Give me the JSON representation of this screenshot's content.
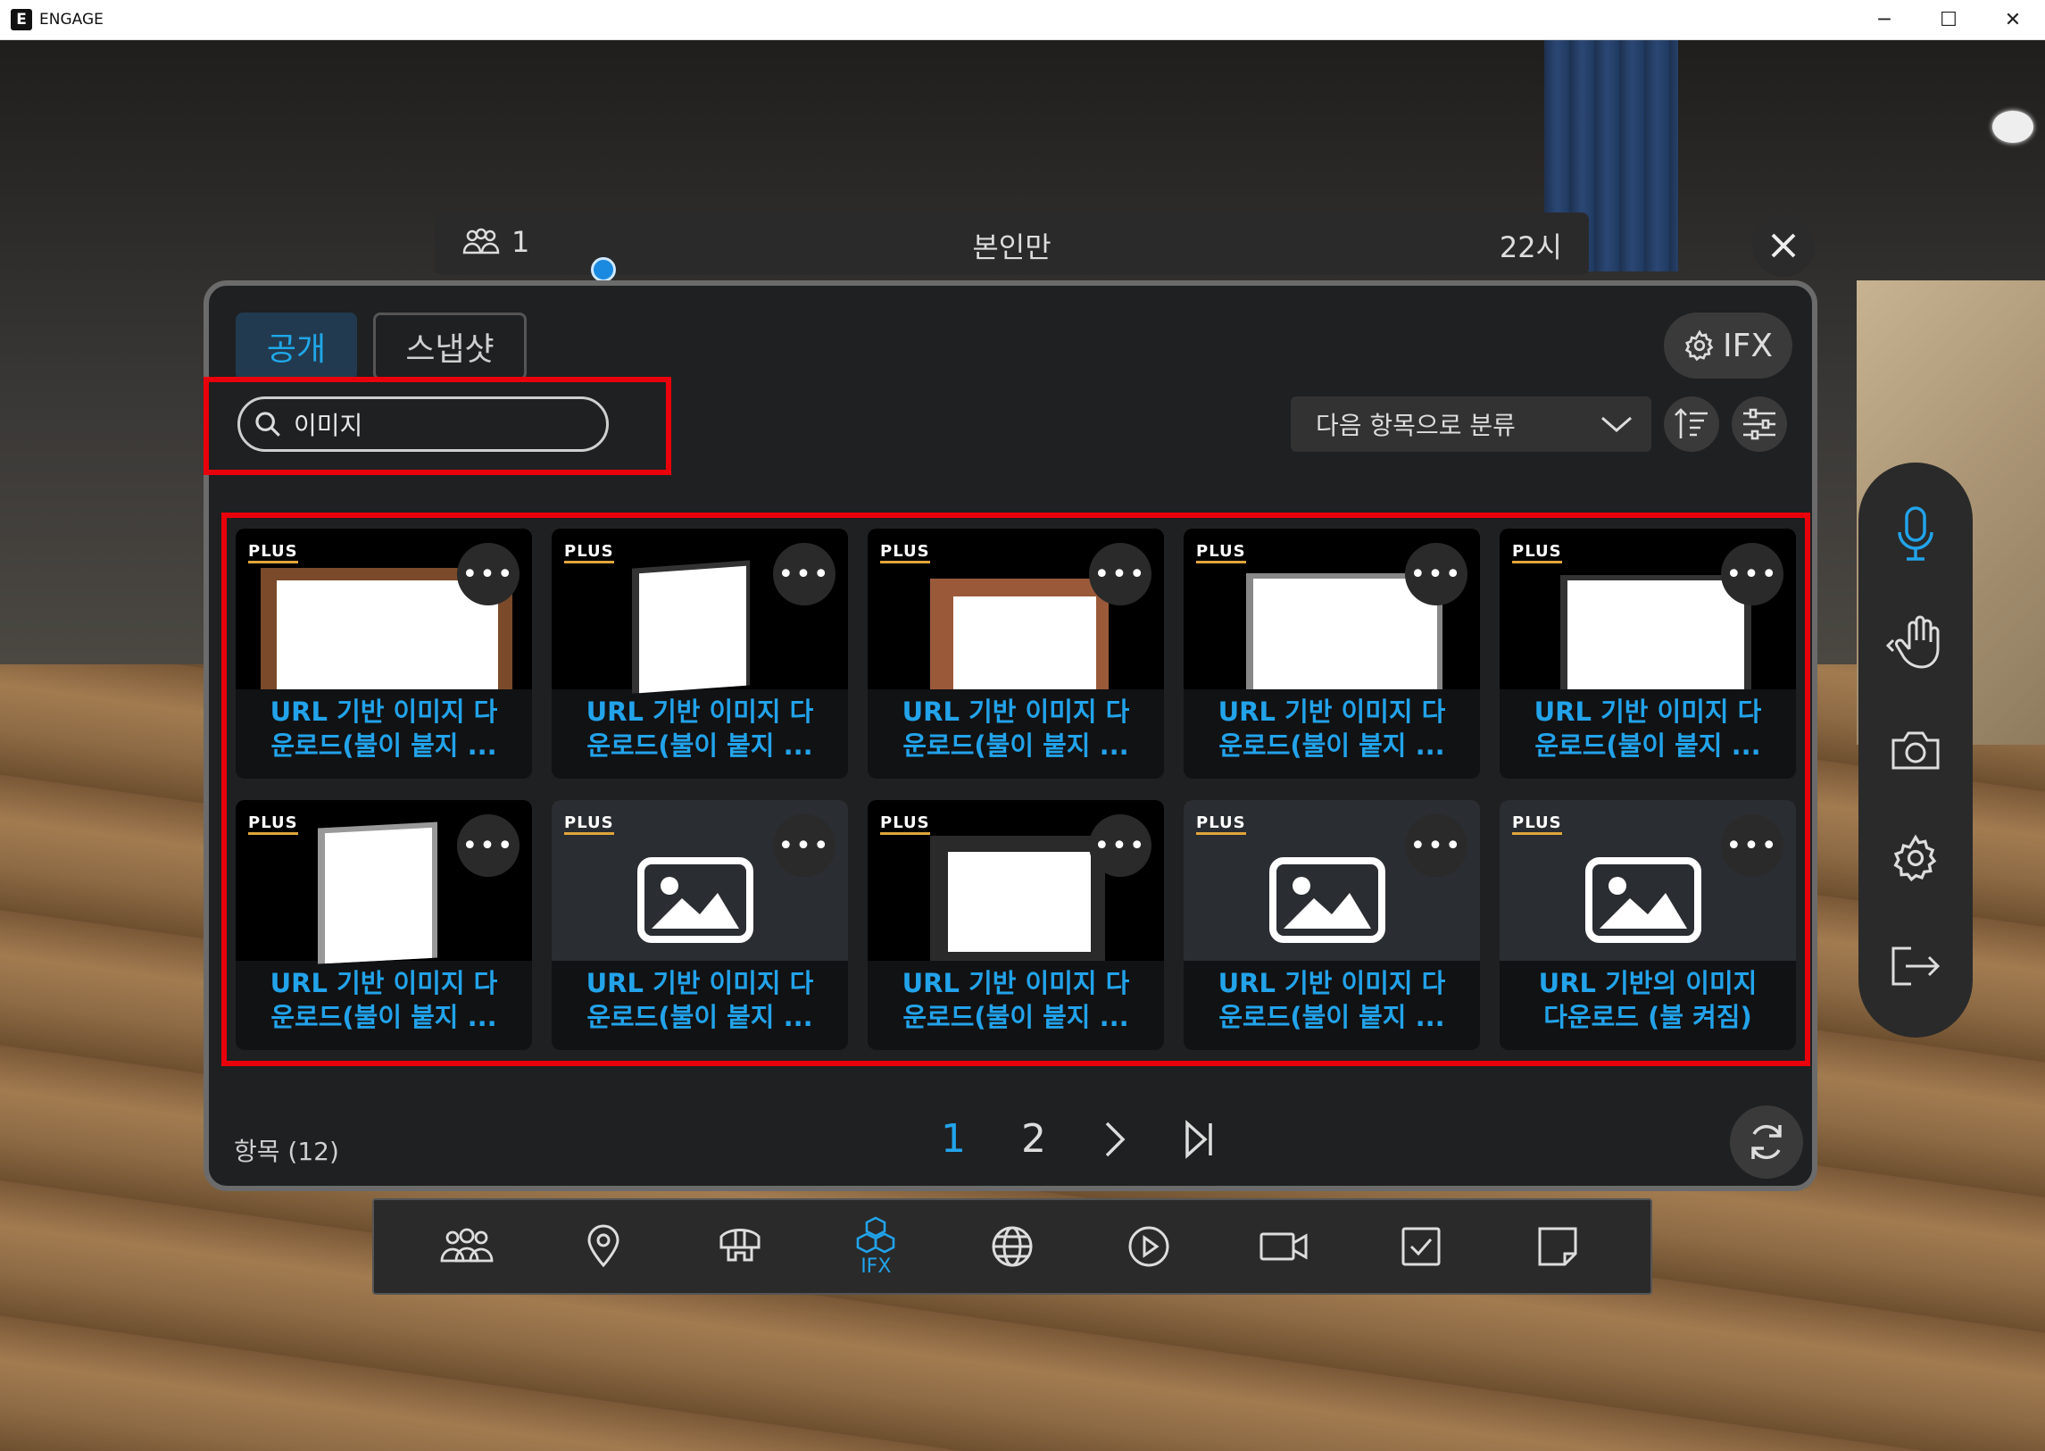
{
  "window": {
    "logo": "E",
    "title": "ENGAGE",
    "minimize": "─",
    "maximize": "☐",
    "close": "✕"
  },
  "session": {
    "user_count": "1",
    "mode": "본인만",
    "time": "22시"
  },
  "panel": {
    "tabs": [
      "공개",
      "스냅샷"
    ],
    "ifx_label": "IFX",
    "search": {
      "value": "이미지",
      "placeholder": ""
    },
    "sort_label": "다음 항목으로 분류",
    "items": [
      {
        "badge": "PLUS",
        "line1": "URL 기반 이미지 다",
        "line2": "운로드(불이 붙지 ...",
        "thumb": "ornate-frame"
      },
      {
        "badge": "PLUS",
        "line1": "URL 기반 이미지 다",
        "line2": "운로드(불이 붙지 ...",
        "thumb": "slim-frame"
      },
      {
        "badge": "PLUS",
        "line1": "URL 기반 이미지 다",
        "line2": "운로드(불이 붙지 ...",
        "thumb": "wood-frame"
      },
      {
        "badge": "PLUS",
        "line1": "URL 기반 이미지 다",
        "line2": "운로드(불이 붙지 ...",
        "thumb": "silver-frame"
      },
      {
        "badge": "PLUS",
        "line1": "URL 기반 이미지 다",
        "line2": "운로드(불이 붙지 ...",
        "thumb": "dark-frame"
      },
      {
        "badge": "PLUS",
        "line1": "URL 기반 이미지 다",
        "line2": "운로드(불이 붙지 ...",
        "thumb": "portrait-frame"
      },
      {
        "badge": "PLUS",
        "line1": "URL 기반 이미지 다",
        "line2": "운로드(불이 붙지 ...",
        "thumb": "image-icon"
      },
      {
        "badge": "PLUS",
        "line1": "URL 기반 이미지 다",
        "line2": "운로드(불이 붙지 ...",
        "thumb": "black-frame"
      },
      {
        "badge": "PLUS",
        "line1": "URL 기반 이미지 다",
        "line2": "운로드(불이 붙지 ...",
        "thumb": "image-icon"
      },
      {
        "badge": "PLUS",
        "line1": "URL 기반의 이미지",
        "line2": "다운로드 (불 켜짐)",
        "thumb": "image-icon"
      }
    ],
    "item_count_label": "항목 (12)",
    "pagination": {
      "pages": [
        "1",
        "2"
      ],
      "current": "1"
    }
  },
  "toolbar": {
    "items": [
      {
        "icon": "users-icon",
        "label": ""
      },
      {
        "icon": "location-pin-icon",
        "label": ""
      },
      {
        "icon": "vr-headset-icon",
        "label": ""
      },
      {
        "icon": "cubes-icon",
        "label": "IFX",
        "active": true
      },
      {
        "icon": "globe-icon",
        "label": ""
      },
      {
        "icon": "play-icon",
        "label": ""
      },
      {
        "icon": "video-camera-icon",
        "label": ""
      },
      {
        "icon": "checkbox-icon",
        "label": ""
      },
      {
        "icon": "note-icon",
        "label": ""
      }
    ]
  },
  "sidebar": {
    "items": [
      "microphone-icon",
      "raise-hand-icon",
      "camera-icon",
      "settings-icon",
      "exit-icon"
    ]
  },
  "colors": {
    "accent": "#22a3ea",
    "highlight": "#e8000b",
    "badge_underline": "#e0a63c"
  }
}
